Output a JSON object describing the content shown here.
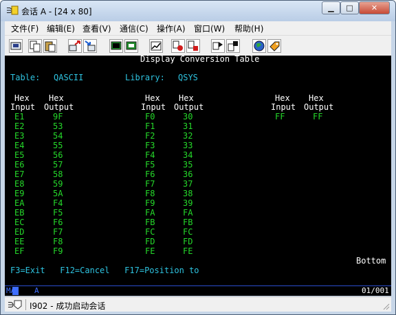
{
  "window": {
    "title": "会话 A - [24 x 80]",
    "minimize": "▁",
    "maximize": "□",
    "close": "✕"
  },
  "menu": [
    {
      "label": "文件(F)"
    },
    {
      "label": "编辑(E)"
    },
    {
      "label": "查看(V)"
    },
    {
      "label": "通信(C)"
    },
    {
      "label": "操作(A)"
    },
    {
      "label": "窗口(W)"
    },
    {
      "label": "帮助(H)"
    }
  ],
  "toolbar": [
    {
      "icon": "print-screen-icon"
    },
    {
      "icon": "copy-icon"
    },
    {
      "icon": "paste-icon"
    },
    {
      "icon": "send-file-icon"
    },
    {
      "icon": "receive-file-icon"
    },
    {
      "icon": "display-icon"
    },
    {
      "icon": "keyboard-map-icon"
    },
    {
      "icon": "graph-icon"
    },
    {
      "icon": "record-macro-icon"
    },
    {
      "icon": "stop-macro-icon"
    },
    {
      "icon": "play-macro-icon"
    },
    {
      "icon": "macro-list-icon"
    },
    {
      "icon": "globe-icon"
    },
    {
      "icon": "help-tag-icon"
    }
  ],
  "screen": {
    "header": "Display Conversion Table",
    "table_label": "Table:",
    "table_value": "QASCII",
    "library_label": "Library:",
    "library_value": "QSYS",
    "col_hex": "Hex",
    "col_input": "Input",
    "col_output": "Output",
    "col1": {
      "inputs": [
        "E1",
        "E2",
        "E3",
        "E4",
        "E5",
        "E6",
        "E7",
        "E8",
        "E9",
        "EA",
        "EB",
        "EC",
        "ED",
        "EE",
        "EF"
      ],
      "outputs": [
        "9F",
        "53",
        "54",
        "55",
        "56",
        "57",
        "58",
        "59",
        "5A",
        "F4",
        "F5",
        "F6",
        "F7",
        "F8",
        "F9"
      ]
    },
    "col2": {
      "inputs": [
        "F0",
        "F1",
        "F2",
        "F3",
        "F4",
        "F5",
        "F6",
        "F7",
        "F8",
        "F9",
        "FA",
        "FB",
        "FC",
        "FD",
        "FE"
      ],
      "outputs": [
        "30",
        "31",
        "32",
        "33",
        "34",
        "35",
        "36",
        "37",
        "38",
        "39",
        "FA",
        "FB",
        "FC",
        "FD",
        "FE"
      ]
    },
    "col3": {
      "inputs": [
        "FF"
      ],
      "outputs": [
        "FF"
      ]
    },
    "bottom": "Bottom",
    "fkeys": "F3=Exit   F12=Cancel   F17=Position to"
  },
  "oia": {
    "ma": "MA",
    "mode": "A",
    "position": "01/001"
  },
  "status": {
    "text": "I902  -  成功启动会话"
  }
}
